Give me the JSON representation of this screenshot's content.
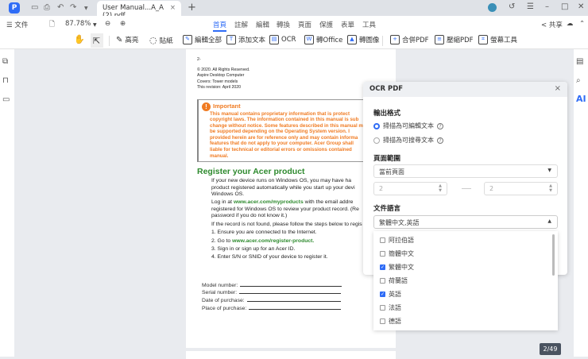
{
  "titlebar": {
    "logo": "P",
    "tab_title": "User Manual...A_A (2).pdf",
    "close": "×",
    "new_tab": "+",
    "icons": [
      "save-icon",
      "print-icon",
      "undo-icon",
      "redo-icon"
    ]
  },
  "menubar": {
    "file": "文件",
    "zoom": "87.78%",
    "tabs": [
      "首頁",
      "註解",
      "編輯",
      "轉換",
      "頁面",
      "保護",
      "表單",
      "工具"
    ],
    "active_tab": "首頁",
    "share": "共享"
  },
  "toolbar": {
    "items": [
      "高亮",
      "貼紙",
      "編輯全部",
      "添加文本",
      "OCR",
      "轉Office",
      "轉圖像",
      "合併PDF",
      "壓縮PDF",
      "螢幕工具"
    ]
  },
  "document": {
    "page_label": "2-",
    "copyright": [
      "© 2020. All Rights Reserved.",
      "Aspire Desktop Computer",
      "Covers: Tower models",
      "This revision: April 2020"
    ],
    "important_title": "Important",
    "important_lines": [
      "This manual contains proprietary information that is protect",
      "copyright laws. The information contained in this manual is sub",
      "change without notice. Some features described in this manual m",
      "be supported depending on the Operating System version. I",
      "provided herein are for reference only and may contain informa",
      "features that do not apply to your computer. Acer Group shall",
      "liable for technical or editorial errors or omissions contained",
      "manual."
    ],
    "register_title": "Register your Acer product",
    "p1": [
      "If your new device runs on Windows OS, you may have ha",
      "product registered automatically while you start up your devi",
      "Windows OS."
    ],
    "p2_pre": "Log in at ",
    "p2_link": "www.acer.com/myproducts",
    "p2_post": " with the email addre",
    "p2b": [
      "registered for Windows OS to review your product record. (Re",
      "password if you do  not know it.)"
    ],
    "p3": "If the record is not found, please follow the steps below to regis",
    "step1": "1. Ensure you are connected to the Internet.",
    "step2_pre": "2. Go to ",
    "step2_link": "www.acer.com/register-product.",
    "step3": "3. Sign in or sign up for an Acer ID.",
    "step4": "4. Enter S/N or SNID of your device to register it.",
    "fields": [
      "Model number:",
      "Serial number:",
      "Date of purchase:",
      "Place of purchase:"
    ]
  },
  "ocr_panel": {
    "title": "OCR PDF",
    "close": "×",
    "output_format_label": "輸出格式",
    "options": [
      {
        "label": "掃描為可編輯文本",
        "selected": true
      },
      {
        "label": "掃描為可搜尋文本",
        "selected": false
      }
    ],
    "help": "?",
    "page_range_label": "頁面範圍",
    "page_range_value": "當前頁面",
    "from": "2",
    "to": "2",
    "language_label": "文件語言",
    "language_value": "繁體中文,英語",
    "languages": [
      {
        "label": "阿拉伯語",
        "checked": false
      },
      {
        "label": "簡體中文",
        "checked": false
      },
      {
        "label": "繁體中文",
        "checked": true
      },
      {
        "label": "荷蘭語",
        "checked": false
      },
      {
        "label": "英語",
        "checked": true
      },
      {
        "label": "法語",
        "checked": false
      },
      {
        "label": "德語",
        "checked": false
      }
    ]
  },
  "right_sidebar": {
    "ai": "AI"
  },
  "page_indicator": "2/49",
  "colors": {
    "accent": "#2f6cf6",
    "important": "#f07b22",
    "link": "#2e8a2e"
  }
}
